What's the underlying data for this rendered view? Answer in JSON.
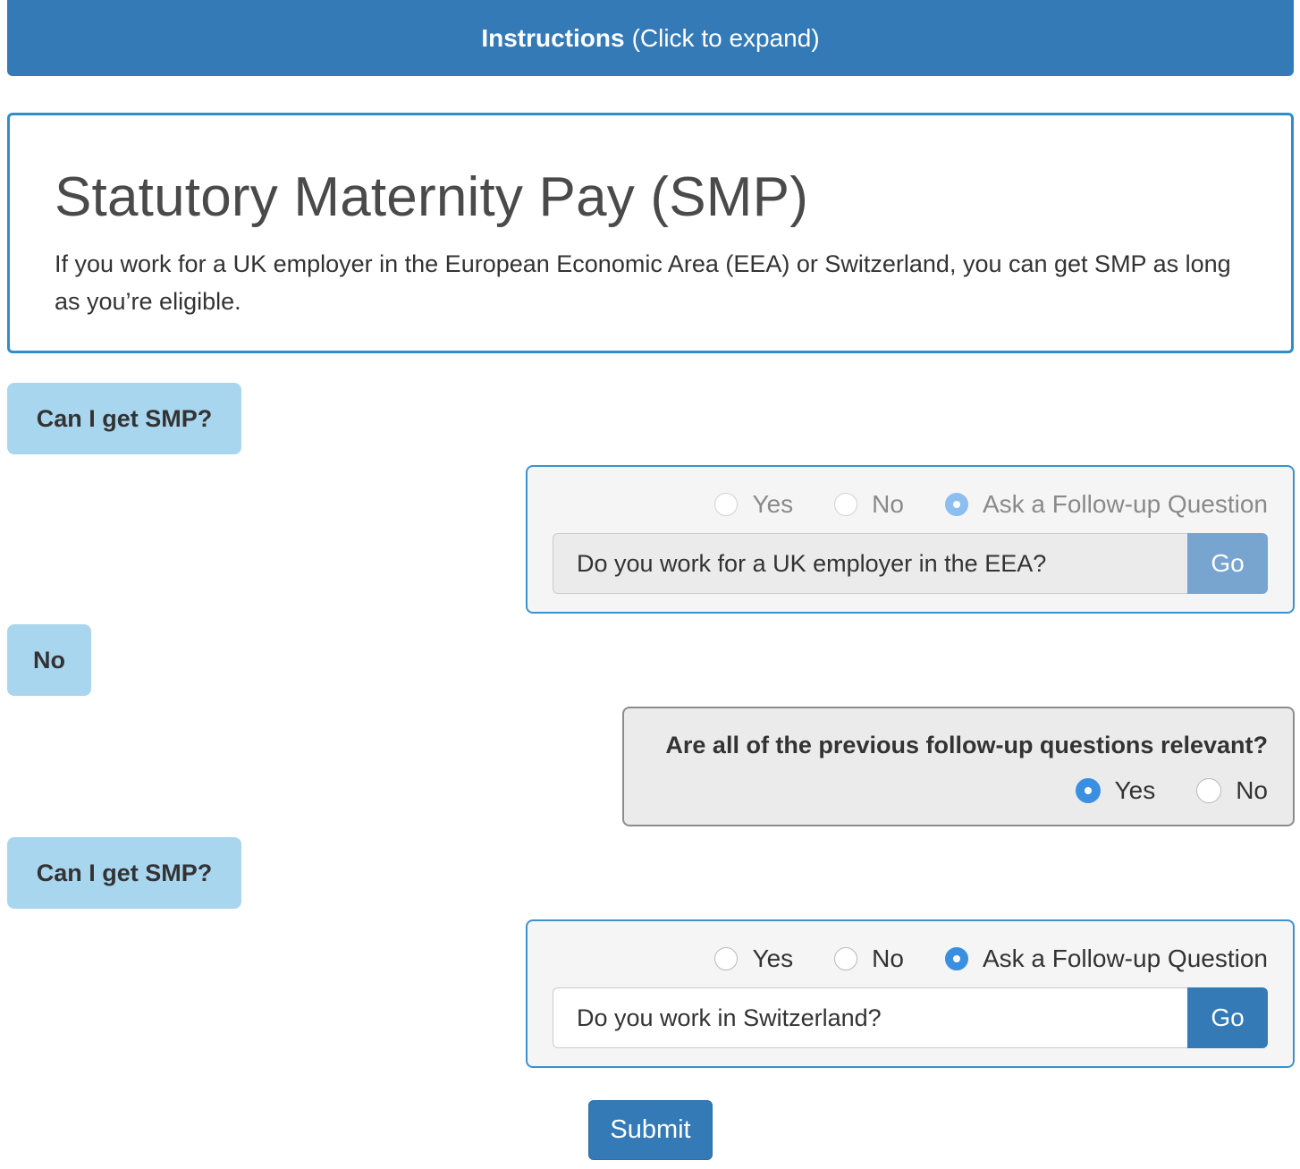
{
  "instructions": {
    "bold": "Instructions",
    "rest": "(Click to expand)"
  },
  "intro": {
    "title": "Statutory Maternity Pay (SMP)",
    "text": "If you work for a UK employer in the European Economic Area (EEA) or Switzerland, you can get SMP as long as you’re eligible."
  },
  "conversation": [
    {
      "user_message": "Can I get SMP?",
      "response": {
        "options": [
          "Yes",
          "No",
          "Ask a Follow-up Question"
        ],
        "selected": "Ask a Follow-up Question",
        "follow_up_value": "Do you work for a UK employer in the EEA?",
        "go_label": "Go",
        "disabled": true
      }
    },
    {
      "user_message": "No"
    },
    {
      "relevance": {
        "question": "Are all of the previous follow-up questions relevant?",
        "options": [
          "Yes",
          "No"
        ],
        "selected": "Yes"
      }
    },
    {
      "user_message": "Can I get SMP?",
      "response": {
        "options": [
          "Yes",
          "No",
          "Ask a Follow-up Question"
        ],
        "selected": "Ask a Follow-up Question",
        "follow_up_value": "Do you work in Switzerland?",
        "go_label": "Go",
        "disabled": false
      }
    }
  ],
  "submit_label": "Submit",
  "colors": {
    "primary": "#337ab7",
    "bubble": "#a9d6ef",
    "panel_border": "#3a93cf",
    "radio_checked": "#3b8fe0"
  }
}
